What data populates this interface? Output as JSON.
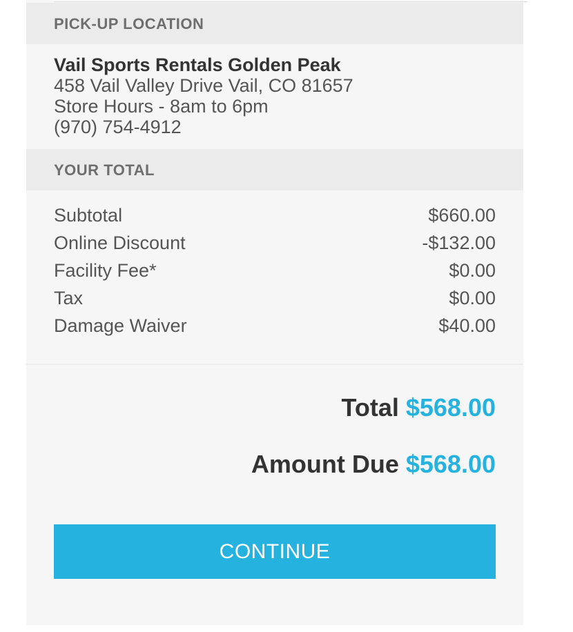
{
  "pickup": {
    "header": "PICK-UP LOCATION",
    "store_name": "Vail Sports Rentals Golden Peak",
    "address": "458 Vail Valley Drive Vail, CO 81657",
    "hours": "Store Hours - 8am to 6pm",
    "phone": "(970) 754-4912"
  },
  "totals": {
    "header": "YOUR TOTAL",
    "lines": [
      {
        "label": "Subtotal",
        "value": "$660.00"
      },
      {
        "label": "Online Discount",
        "value": "-$132.00"
      },
      {
        "label": "Facility Fee*",
        "value": "$0.00"
      },
      {
        "label": "Tax",
        "value": "$0.00"
      },
      {
        "label": "Damage Waiver",
        "value": "$40.00"
      }
    ],
    "total_label": "Total",
    "total_value": "$568.00",
    "due_label": "Amount Due",
    "due_value": "$568.00"
  },
  "continue_label": "CONTINUE",
  "colors": {
    "accent": "#25b2df",
    "header_bg": "#ebebeb",
    "panel_bg": "#f6f6f6"
  }
}
